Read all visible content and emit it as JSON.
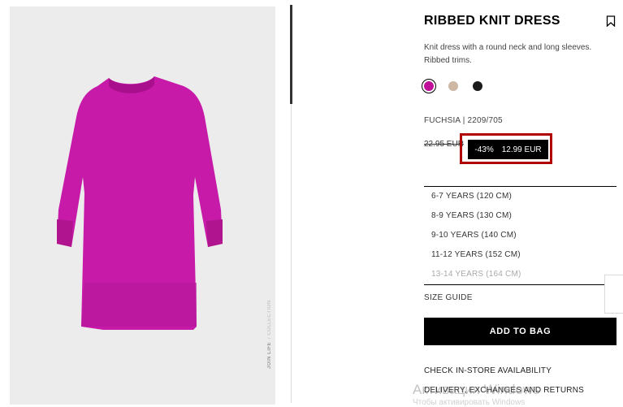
{
  "product": {
    "title": "RIBBED KNIT DRESS",
    "description": "Knit dress with a round neck and long sleeves. Ribbed trims.",
    "color_code": "FUCHSIA | 2209/705",
    "old_price": "22.95 EUR",
    "discount": "-43%",
    "price": "12.99 EUR"
  },
  "colors": [
    {
      "name": "fuchsia",
      "hex": "#c0109a",
      "selected": true
    },
    {
      "name": "beige",
      "hex": "#cdb8a6",
      "selected": false
    },
    {
      "name": "black",
      "hex": "#1c1c1c",
      "selected": false
    }
  ],
  "sizes": [
    {
      "label": "6-7 YEARS (120 CM)",
      "available": true
    },
    {
      "label": "8-9 YEARS (130 CM)",
      "available": true
    },
    {
      "label": "9-10 YEARS (140 CM)",
      "available": true
    },
    {
      "label": "11-12 YEARS (152 CM)",
      "available": true
    },
    {
      "label": "13-14 YEARS (164 CM)",
      "available": false
    }
  ],
  "actions": {
    "size_guide": "SIZE GUIDE",
    "add_to_bag": "ADD TO BAG",
    "check_store": "CHECK IN-STORE AVAILABILITY",
    "delivery": "DELIVERY, EXCHANGES AND RETURNS"
  },
  "image_caption": {
    "strong": "JOIN LIFE",
    "light": "/ COLLECTION"
  },
  "overlay": {
    "watermark": "Активация Windows",
    "watermark_sub": "Чтобы активировать Windows"
  },
  "accent": {
    "dress": "#c71aa8",
    "highlight": "#b00000"
  }
}
